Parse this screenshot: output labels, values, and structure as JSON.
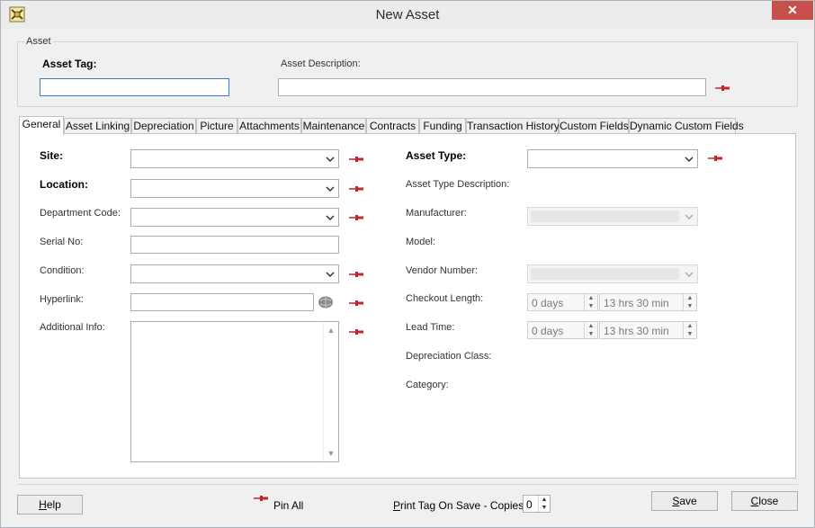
{
  "window": {
    "title": "New Asset",
    "close_glyph": "✕"
  },
  "asset": {
    "group_title": "Asset",
    "tag_label": "Asset Tag:",
    "tag_value": "",
    "description_label": "Asset Description:",
    "description_value": ""
  },
  "tabs": [
    {
      "label": "General",
      "active": true
    },
    {
      "label": "Asset Linking"
    },
    {
      "label": "Depreciation"
    },
    {
      "label": "Picture"
    },
    {
      "label": "Attachments"
    },
    {
      "label": "Maintenance"
    },
    {
      "label": "Contracts"
    },
    {
      "label": "Funding"
    },
    {
      "label": "Transaction History"
    },
    {
      "label": "Custom Fields"
    },
    {
      "label": "Dynamic Custom Fields"
    }
  ],
  "general": {
    "site_label": "Site:",
    "location_label": "Location:",
    "department_label": "Department Code:",
    "serial_label": "Serial No:",
    "condition_label": "Condition:",
    "hyperlink_label": "Hyperlink:",
    "additional_label": "Additional Info:",
    "asset_type_label": "Asset Type:",
    "asset_type_desc_label": "Asset Type Description:",
    "manufacturer_label": "Manufacturer:",
    "model_label": "Model:",
    "vendor_label": "Vendor Number:",
    "checkout_label": "Checkout Length:",
    "checkout_days": "0 days",
    "checkout_time": "13 hrs 30 min",
    "lead_label": "Lead Time:",
    "lead_days": "0 days",
    "lead_time": "13 hrs 30 min",
    "depreciation_label": "Depreciation Class:",
    "category_label": "Category:"
  },
  "footer": {
    "help": "Help",
    "pin_all": "Pin All",
    "print_label": "Print Tag On Save - Copies:",
    "copies": "0",
    "save": "Save",
    "close": "Close"
  },
  "colors": {
    "pin": "#c0282b",
    "accent": "#3d7bc4",
    "close_button": "#c7504c"
  },
  "icons": {
    "app": "asset-app-icon",
    "pin": "pushpin-icon",
    "hyperlink": "globe-icon"
  }
}
